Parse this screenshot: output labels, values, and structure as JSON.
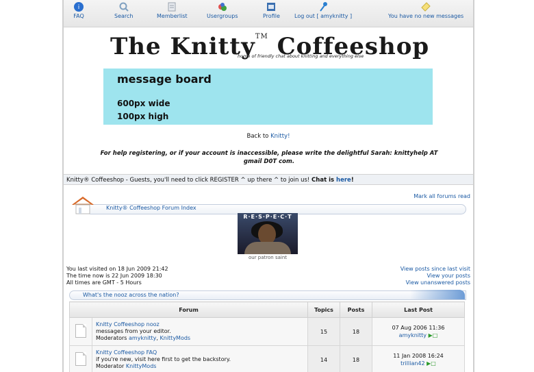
{
  "nav": [
    {
      "label": "FAQ",
      "icon": "faq-icon",
      "color": "#2a6fcf"
    },
    {
      "label": "Search",
      "icon": "search-icon",
      "color": "#7fa0c0"
    },
    {
      "label": "Memberlist",
      "icon": "memberlist-icon",
      "color": "#9aa3ad"
    },
    {
      "label": "Usergroups",
      "icon": "usergroups-icon",
      "color": "#e05050"
    },
    {
      "label": "Profile",
      "icon": "profile-icon",
      "color": "#3a6fb0"
    },
    {
      "label": "Log out [ amyknitty ]",
      "icon": "key-icon",
      "color": "#2a7fd0"
    },
    {
      "label": "You have no new messages",
      "icon": "message-icon",
      "color": "#f0d040"
    }
  ],
  "logo": {
    "title": "The Knitty",
    "tm": "TM",
    "title2": "Coffeeshop",
    "tagline": "home of friendly chat about knitting and everything else"
  },
  "banner": {
    "line1": "message board",
    "line2": "600px wide",
    "line3": "100px high",
    "color": "#9ee4ee"
  },
  "backto": {
    "prefix": "Back to ",
    "link": "Knitty!"
  },
  "help": "For help registering, or if your account is inaccessible, please write the delightful Sarah: knittyhelp AT gmail D0T com.",
  "guest": {
    "text": "Knitty® Coffeeshop - Guests, you'll need to click REGISTER ^ up there ^ to join us! ",
    "chat": "Chat",
    "is": " is ",
    "here": "here",
    "bang": "!"
  },
  "mark_all": "Mark all forums read",
  "breadcrumb": "Knitty® Coffeeshop Forum Index",
  "respect": {
    "header": "R·E·S·P·E·C·T",
    "caption": "our patron saint"
  },
  "visit": {
    "last": "You last visited on 18 Jun 2009 21:42",
    "now": "The time now is 22 Jun 2009 18:30",
    "tz": "All times are GMT - 5 Hours"
  },
  "right_links": [
    "View posts since last visit",
    "View your posts",
    "View unanswered posts"
  ],
  "category": "What's the nooz across the nation?",
  "table": {
    "headers": [
      "Forum",
      "Topics",
      "Posts",
      "Last Post"
    ],
    "rows": [
      {
        "name": "Knitty Coffeeshop nooz",
        "desc": "messages from your editor.",
        "mods_label": "Moderators ",
        "mods": [
          "amyknitty",
          "KnittyMods"
        ],
        "topics": "15",
        "posts": "18",
        "date": "07 Aug 2006 11:36",
        "user": "amyknitty"
      },
      {
        "name": "Knitty Coffeeshop FAQ",
        "desc": "if you're new, visit here first to get the backstory.",
        "mods_label": "Moderator ",
        "mods": [
          "KnittyMods"
        ],
        "topics": "14",
        "posts": "18",
        "date": "11 Jan 2008 16:24",
        "user": "trillian42"
      }
    ]
  }
}
